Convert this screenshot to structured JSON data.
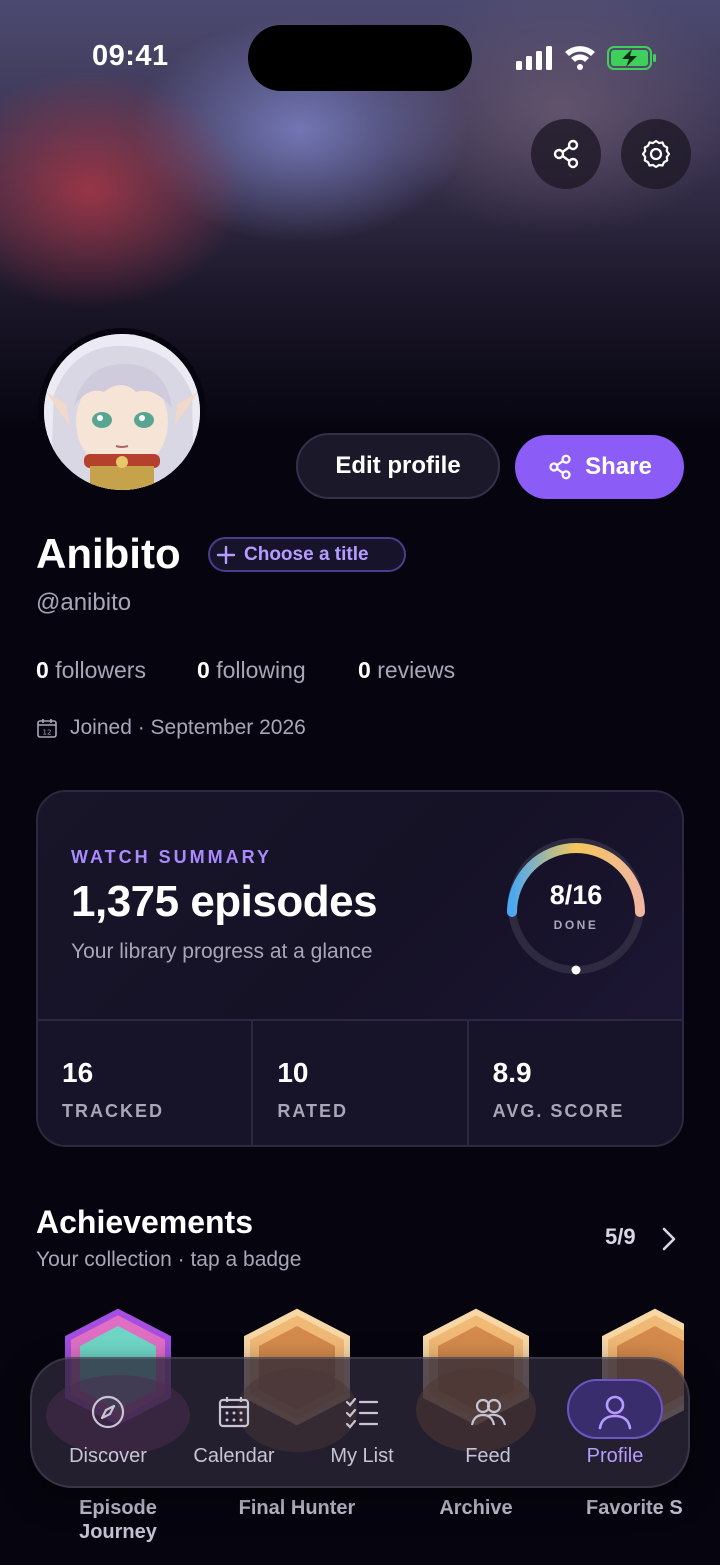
{
  "status_bar": {
    "time": "09:41"
  },
  "header_actions": {
    "share_icon": "share-icon",
    "settings_icon": "gear-icon"
  },
  "profile": {
    "name": "Anibito",
    "handle": "@anibito",
    "title_chip": "Choose a title",
    "edit_label": "Edit profile",
    "share_label": "Share",
    "followers_count": "0",
    "followers_label": "followers",
    "following_count": "0",
    "following_label": "following",
    "reviews_count": "0",
    "reviews_label": "reviews",
    "joined": "Joined · September 2026"
  },
  "watch_summary": {
    "eyebrow": "WATCH SUMMARY",
    "episodes": "1,375 episodes",
    "subtitle": "Your library progress at a glance",
    "ring_value": "8/16",
    "ring_label": "DONE",
    "ring_progress": 0.5,
    "stats": [
      {
        "value": "16",
        "label": "TRACKED"
      },
      {
        "value": "10",
        "label": "RATED"
      },
      {
        "value": "8.9",
        "label": "AVG. SCORE"
      }
    ]
  },
  "achievements": {
    "title": "Achievements",
    "subtitle": "Your collection · tap a badge",
    "count": "5/9",
    "badges": [
      {
        "name_line1": "Episode",
        "name_line2": "Journey"
      },
      {
        "name_line1": "Final Hunter"
      },
      {
        "name_line1": "Archive"
      },
      {
        "name_line1": "Favorite S"
      }
    ]
  },
  "tabbar": {
    "tabs": [
      {
        "label": "Discover",
        "icon": "compass-icon"
      },
      {
        "label": "Calendar",
        "icon": "calendar-icon"
      },
      {
        "label": "My List",
        "icon": "checklist-icon"
      },
      {
        "label": "Feed",
        "icon": "people-icon"
      },
      {
        "label": "Profile",
        "icon": "person-icon",
        "active": true
      }
    ]
  },
  "colors": {
    "accent": "#8b5cf6",
    "accent_light": "#b69cff",
    "background": "#06050f"
  }
}
